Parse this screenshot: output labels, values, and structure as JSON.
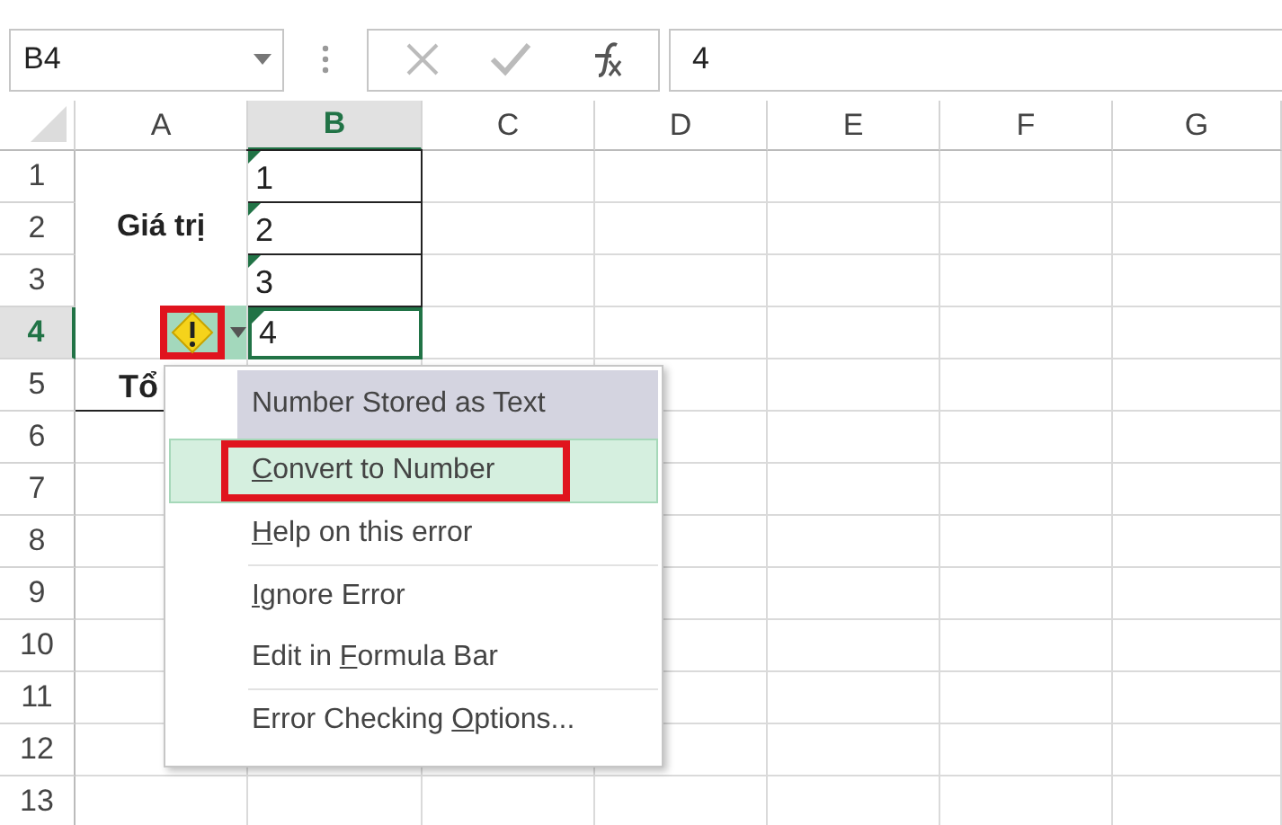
{
  "name_box": {
    "value": "B4"
  },
  "formula_buttons": [
    {
      "kind": "cancel",
      "disabled": true
    },
    {
      "kind": "enter",
      "disabled": true
    },
    {
      "kind": "function",
      "disabled": false
    }
  ],
  "formula_bar": {
    "value": "4"
  },
  "columns": [
    {
      "label": "A",
      "selected": false
    },
    {
      "label": "B",
      "selected": true
    },
    {
      "label": "C",
      "selected": false
    },
    {
      "label": "D",
      "selected": false
    },
    {
      "label": "E",
      "selected": false
    },
    {
      "label": "F",
      "selected": false
    },
    {
      "label": "G",
      "selected": false
    }
  ],
  "merged_label": {
    "text": "Giá trị"
  },
  "rows": [
    {
      "label": "1",
      "selected": false,
      "column_b": "1",
      "text_warning": true
    },
    {
      "label": "2",
      "selected": false,
      "column_b": "2",
      "text_warning": true
    },
    {
      "label": "3",
      "selected": false,
      "column_b": "3",
      "text_warning": true
    },
    {
      "label": "4",
      "selected": true,
      "column_b": "4",
      "text_warning": true
    },
    {
      "label": "5",
      "selected": false,
      "column_a": "Tổ"
    },
    {
      "label": "6",
      "selected": false
    },
    {
      "label": "7",
      "selected": false
    },
    {
      "label": "8",
      "selected": false
    },
    {
      "label": "9",
      "selected": false
    },
    {
      "label": "10",
      "selected": false
    },
    {
      "label": "11",
      "selected": false
    },
    {
      "label": "12",
      "selected": false
    },
    {
      "label": "13",
      "selected": false
    }
  ],
  "error_button": {
    "annotated": true
  },
  "error_menu": {
    "title": "Number Stored as Text",
    "items": [
      {
        "key": "C",
        "after": "onvert to Number",
        "selected": true,
        "annotated": true,
        "separator_after": false
      },
      {
        "key": "H",
        "after": "elp on this error",
        "selected": false,
        "annotated": false,
        "separator_after": true
      },
      {
        "key": "I",
        "after": "gnore Error",
        "selected": false,
        "annotated": false,
        "separator_after": false
      },
      {
        "before": "Edit in ",
        "key": "F",
        "after": "ormula Bar",
        "selected": false,
        "annotated": false,
        "separator_after": true
      },
      {
        "before": "Error Checking ",
        "key": "O",
        "after": "ptions...",
        "selected": false,
        "annotated": false,
        "separator_after": false
      }
    ]
  }
}
